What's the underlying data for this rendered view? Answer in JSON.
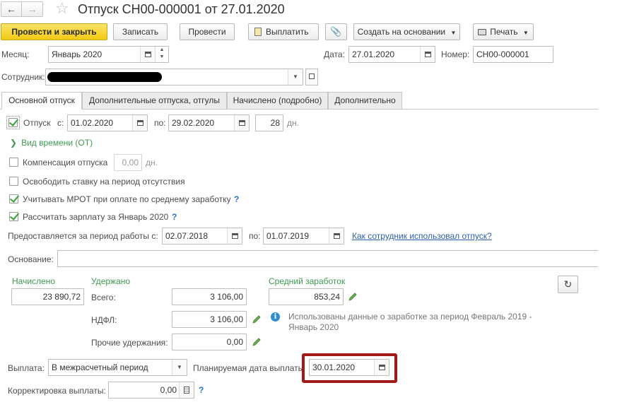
{
  "window": {
    "title": "Отпуск СН00-000001 от 27.01.2020"
  },
  "toolbar": {
    "post_close": "Провести и закрыть",
    "save": "Записать",
    "post": "Провести",
    "pay": "Выплатить",
    "create_based": "Создать на основании",
    "print": "Печать"
  },
  "header": {
    "month_label": "Месяц:",
    "month_value": "Январь 2020",
    "date_label": "Дата:",
    "date_value": "27.01.2020",
    "number_label": "Номер:",
    "number_value": "СН00-000001",
    "employee_label": "Сотрудник:",
    "employee_value": ""
  },
  "tabs": [
    {
      "label": "Основной отпуск"
    },
    {
      "label": "Дополнительные отпуска, отгулы"
    },
    {
      "label": "Начислено (подробно)"
    },
    {
      "label": "Дополнительно"
    }
  ],
  "main": {
    "vacation": {
      "label": "Отпуск",
      "from_label": "с:",
      "from": "01.02.2020",
      "to_label": "по:",
      "to": "29.02.2020",
      "days": "28",
      "days_unit": "дн."
    },
    "time_type": "Вид времени (ОТ)",
    "compensation": {
      "label": "Компенсация отпуска",
      "days": "0,00",
      "unit": "дн."
    },
    "free_rate": "Освободить ставку на период отсутствия",
    "mrot": "Учитывать МРОТ при оплате по среднему заработку",
    "calc_salary": "Рассчитать зарплату за Январь 2020",
    "help_mark": "?",
    "period": {
      "label": "Предоставляется за период работы с:",
      "from": "02.07.2018",
      "to_label": "по:",
      "to": "01.07.2019",
      "link": "Как сотрудник использовал отпуск?"
    },
    "basis": {
      "label": "Основание:",
      "value": ""
    }
  },
  "totals": {
    "accrued_label": "Начислено",
    "accrued": "23 890,72",
    "withheld_label": "Удержано",
    "total_label": "Всего:",
    "total": "3 106,00",
    "ndfl_label": "НДФЛ:",
    "ndfl": "3 106,00",
    "other_label": "Прочие удержания:",
    "other": "0,00",
    "avg_label": "Средний заработок",
    "avg": "853,24",
    "info": "Использованы данные о заработке за период Февраль 2019 - Январь 2020"
  },
  "payment": {
    "label": "Выплата:",
    "value": "В межрасчетный период",
    "planned_label": "Планируемая дата выплаты:",
    "planned": "30.01.2020",
    "correction_label": "Корректировка выплаты:",
    "correction": "0,00"
  },
  "colors": {
    "highlight": "#a31a1a",
    "primary_button": "#f2c913",
    "accent_green": "#3e9a52",
    "link": "#2c5fa8"
  }
}
